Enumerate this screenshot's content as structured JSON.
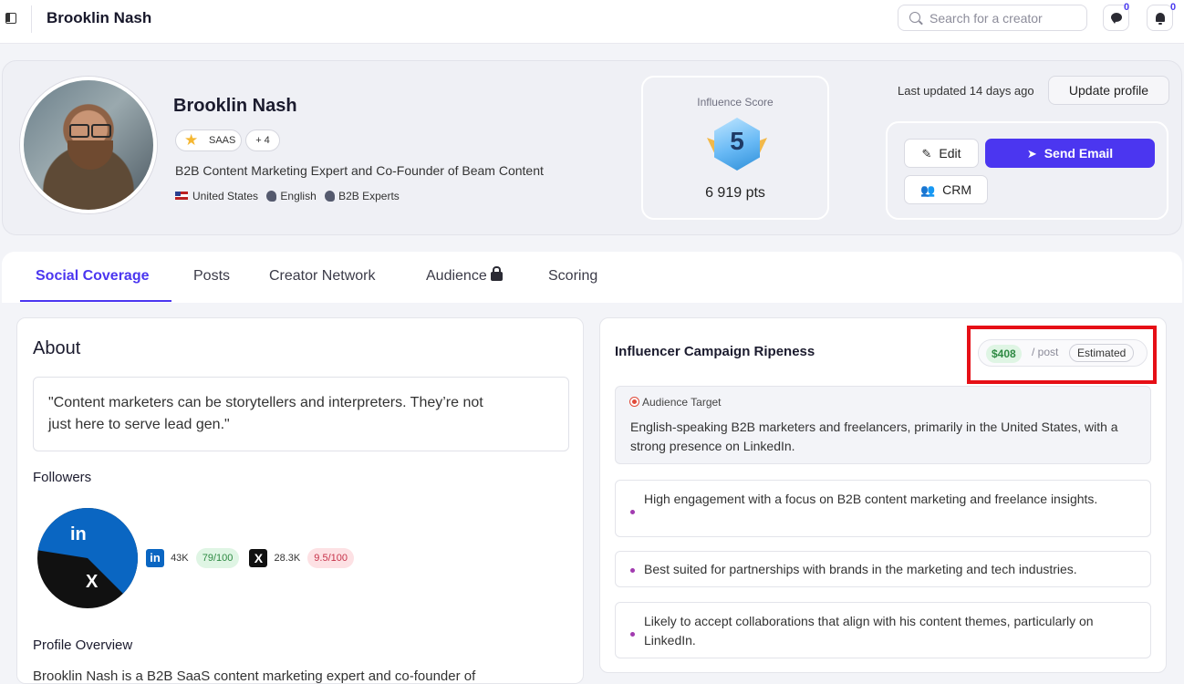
{
  "topbar": {
    "title": "Brooklin Nash",
    "search_placeholder": "Search for a creator",
    "messages_count": "0",
    "notifications_count": "0"
  },
  "profile": {
    "name": "Brooklin Nash",
    "tag_primary": "SAAS",
    "tag_more": "+ 4",
    "bio": "B2B Content Marketing Expert and Co-Founder of Beam Content",
    "country": "United States",
    "language": "English",
    "category": "B2B Experts"
  },
  "influence": {
    "label": "Influence Score",
    "level": "5",
    "points": "6 919 pts"
  },
  "header_actions": {
    "last_updated": "Last updated 14 days ago",
    "update_label": "Update profile",
    "edit_label": "Edit",
    "send_email_label": "Send Email",
    "crm_label": "CRM"
  },
  "tabs": [
    {
      "label": "Social Coverage",
      "active": true
    },
    {
      "label": "Posts",
      "active": false
    },
    {
      "label": "Creator Network",
      "active": false
    },
    {
      "label": "Audience",
      "active": false
    },
    {
      "label": "Scoring",
      "active": false
    }
  ],
  "about": {
    "title": "About",
    "quote_line1": "\"Content marketers can be storytellers and interpreters. They’re not",
    "quote_line2": "just here to serve lead gen.\"",
    "followers_title": "Followers",
    "linkedin": {
      "count": "43K",
      "score": "79/100",
      "share": 0.6,
      "color": "#0a66c2"
    },
    "x": {
      "count": "28.3K",
      "score": "9.5/100",
      "share": 0.4,
      "color": "#111111"
    },
    "overview_title": "Profile Overview",
    "overview_text": "Brooklin Nash is a B2B SaaS content marketing expert and co-founder of"
  },
  "ripeness": {
    "title": "Influencer Campaign Ripeness",
    "price": "$408",
    "price_unit": "/ post",
    "estimated_label": "Estimated",
    "target_label": "Audience Target",
    "target_text": "English-speaking B2B marketers and freelancers, primarily in the United States, with a strong presence on LinkedIn.",
    "insights": [
      "High engagement with a focus on B2B content marketing and freelance insights.",
      "Best suited for partnerships with brands in the marketing and tech industries.",
      "Likely to accept collaborations that align with his content themes, particularly on LinkedIn."
    ]
  },
  "colors": {
    "accent": "#4b36f0",
    "highlight_box": "#e60f16",
    "green_pill": "#2e8a43",
    "red_pill": "#c7334a"
  }
}
